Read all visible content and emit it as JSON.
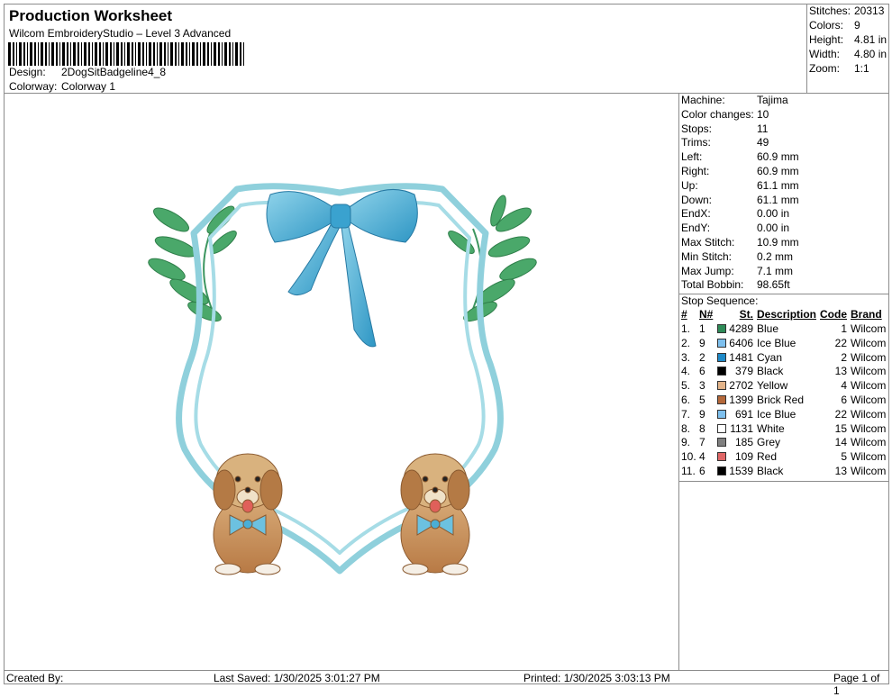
{
  "header": {
    "title": "Production Worksheet",
    "software": "Wilcom EmbroideryStudio – Level 3 Advanced",
    "design_label": "Design:",
    "design_value": "2DogSitBadgeline4_8",
    "colorway_label": "Colorway:",
    "colorway_value": "Colorway 1"
  },
  "stats": [
    {
      "label": "Stitches:",
      "value": "20313"
    },
    {
      "label": "Colors:",
      "value": "9"
    },
    {
      "label": "Height:",
      "value": "4.81 in"
    },
    {
      "label": "Width:",
      "value": "4.80 in"
    },
    {
      "label": "Zoom:",
      "value": "1:1"
    }
  ],
  "properties": [
    {
      "label": "Machine:",
      "value": "Tajima"
    },
    {
      "label": "Color changes:",
      "value": "10"
    },
    {
      "label": "Stops:",
      "value": "11"
    },
    {
      "label": "Trims:",
      "value": "49"
    },
    {
      "label": "Left:",
      "value": "60.9 mm"
    },
    {
      "label": "Right:",
      "value": "60.9 mm"
    },
    {
      "label": "Up:",
      "value": "61.1 mm"
    },
    {
      "label": "Down:",
      "value": "61.1 mm"
    },
    {
      "label": "EndX:",
      "value": "0.00 in"
    },
    {
      "label": "EndY:",
      "value": "0.00 in"
    },
    {
      "label": "Max Stitch:",
      "value": "10.9 mm"
    },
    {
      "label": "Min Stitch:",
      "value": "0.2 mm"
    },
    {
      "label": "Max Jump:",
      "value": "7.1 mm"
    },
    {
      "label": "Total Bobbin:",
      "value": "98.65ft"
    }
  ],
  "stop_sequence": {
    "title": "Stop Sequence:",
    "headers": {
      "idx": "#",
      "n": "N#",
      "st": "St.",
      "desc": "Description",
      "code": "Code",
      "brand": "Brand"
    },
    "rows": [
      {
        "idx": "1.",
        "n": "1",
        "color": "#2e8b57",
        "st": "4289",
        "desc": "Blue",
        "code": "1",
        "brand": "Wilcom"
      },
      {
        "idx": "2.",
        "n": "9",
        "color": "#7ec0ee",
        "st": "6406",
        "desc": "Ice Blue",
        "code": "22",
        "brand": "Wilcom"
      },
      {
        "idx": "3.",
        "n": "2",
        "color": "#1e8ac8",
        "st": "1481",
        "desc": "Cyan",
        "code": "2",
        "brand": "Wilcom"
      },
      {
        "idx": "4.",
        "n": "6",
        "color": "#000000",
        "st": "379",
        "desc": "Black",
        "code": "13",
        "brand": "Wilcom"
      },
      {
        "idx": "5.",
        "n": "3",
        "color": "#e3b48a",
        "st": "2702",
        "desc": "Yellow",
        "code": "4",
        "brand": "Wilcom"
      },
      {
        "idx": "6.",
        "n": "5",
        "color": "#b5683a",
        "st": "1399",
        "desc": "Brick Red",
        "code": "6",
        "brand": "Wilcom"
      },
      {
        "idx": "7.",
        "n": "9",
        "color": "#7ec0ee",
        "st": "691",
        "desc": "Ice Blue",
        "code": "22",
        "brand": "Wilcom"
      },
      {
        "idx": "8.",
        "n": "8",
        "color": "#ffffff",
        "st": "1131",
        "desc": "White",
        "code": "15",
        "brand": "Wilcom"
      },
      {
        "idx": "9.",
        "n": "7",
        "color": "#808080",
        "st": "185",
        "desc": "Grey",
        "code": "14",
        "brand": "Wilcom"
      },
      {
        "idx": "10.",
        "n": "4",
        "color": "#e06666",
        "st": "109",
        "desc": "Red",
        "code": "5",
        "brand": "Wilcom"
      },
      {
        "idx": "11.",
        "n": "6",
        "color": "#000000",
        "st": "1539",
        "desc": "Black",
        "code": "13",
        "brand": "Wilcom"
      }
    ]
  },
  "footer": {
    "created_by": "Created By:",
    "last_saved": "Last Saved: 1/30/2025 3:01:27 PM",
    "printed": "Printed: 1/30/2025 3:03:13 PM",
    "page": "Page 1 of 1"
  },
  "colors": {
    "leaf": "#4aa86a",
    "frame": "#8fd0dc",
    "bow": "#4bb0d6",
    "dog": "#c9935a",
    "border": "#8c8c8c"
  }
}
